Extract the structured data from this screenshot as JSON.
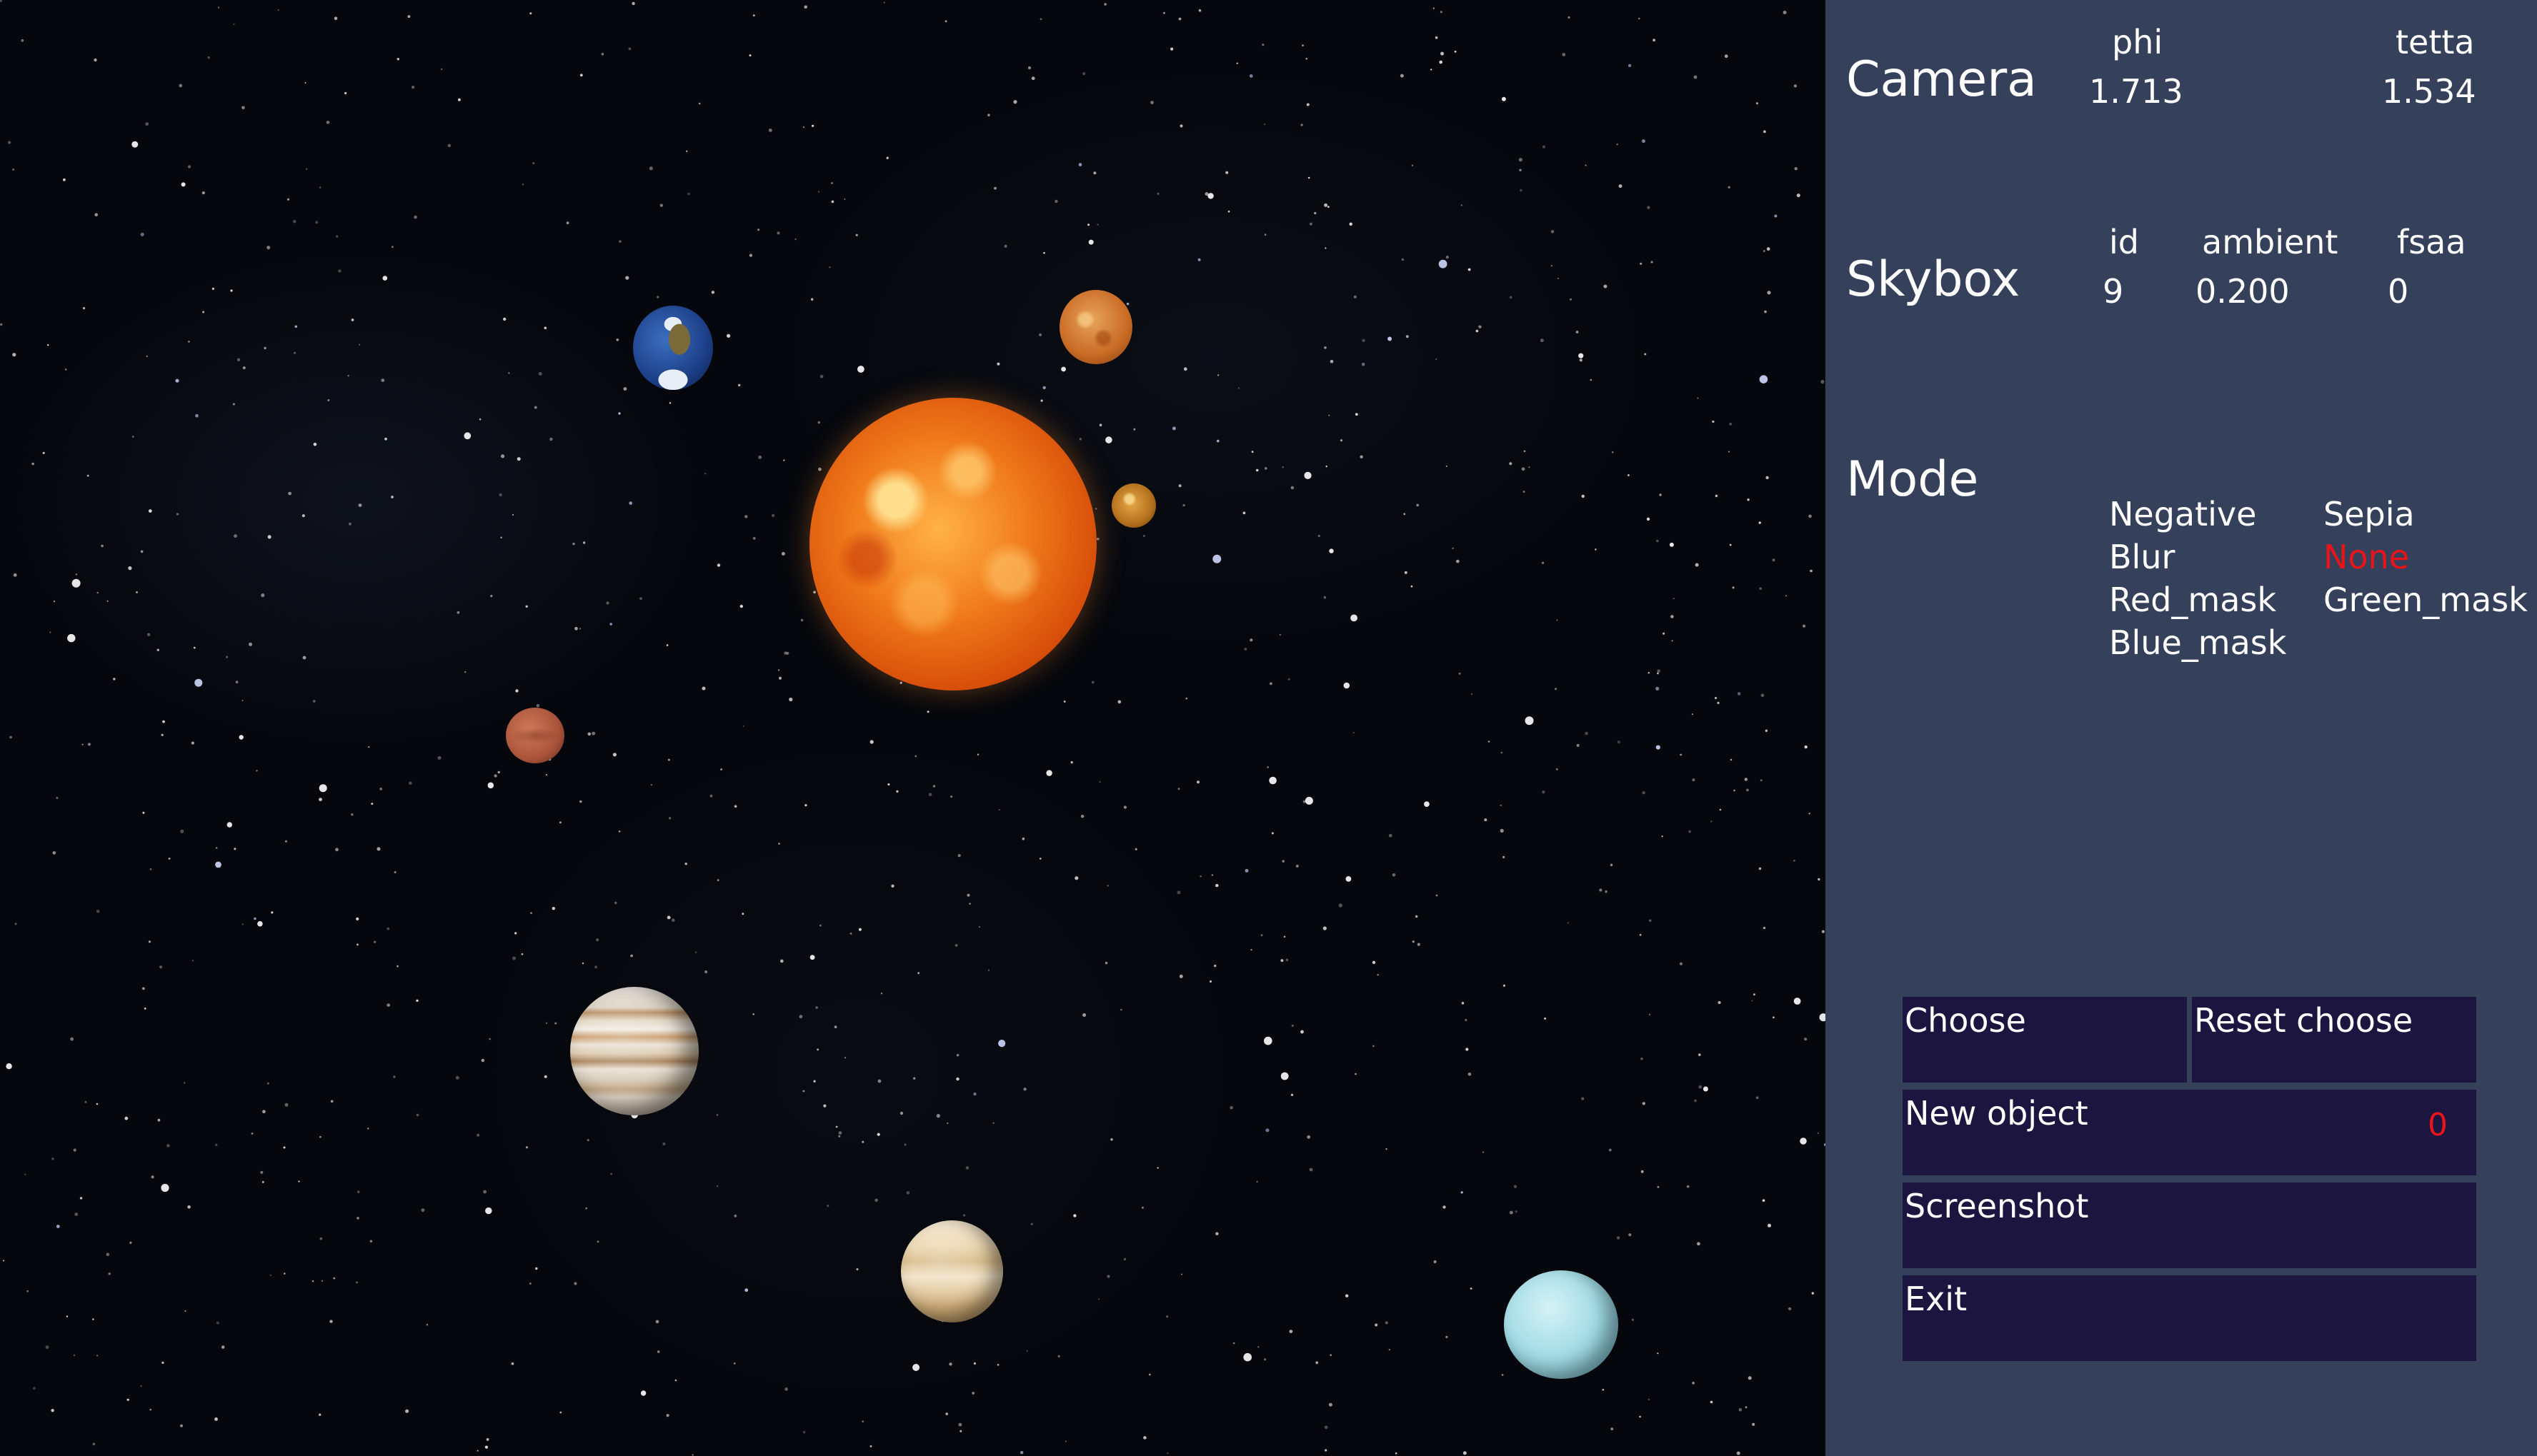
{
  "viewport": {
    "bodies": [
      "sun-icon",
      "earth-icon",
      "planet-icon",
      "planet-icon",
      "mars-icon",
      "jupiter-icon",
      "saturn-icon",
      "uranus-icon"
    ]
  },
  "camera": {
    "title": "Camera",
    "phi_label": "phi",
    "phi_value": "1.713",
    "tetta_label": "tetta",
    "tetta_value": "1.534"
  },
  "skybox": {
    "title": "Skybox",
    "id_label": "id",
    "id_value": "9",
    "ambient_label": "ambient",
    "ambient_value": "0.200",
    "fsaa_label": "fsaa",
    "fsaa_value": "0"
  },
  "mode": {
    "title": "Mode",
    "options": [
      "Negative",
      "Sepia",
      "Blur",
      "None",
      "Red_mask",
      "Green_mask",
      "Blue_mask"
    ],
    "selected": "None",
    "selected_color": "#e8141a"
  },
  "buttons": {
    "choose": "Choose",
    "reset_choose": "Reset choose",
    "new_object": "New object",
    "new_object_count": "0",
    "screenshot": "Screenshot",
    "exit": "Exit"
  },
  "colors": {
    "panel_bg": "#35405a",
    "button_bg": "#1b1540",
    "accent_red": "#e8141a"
  }
}
